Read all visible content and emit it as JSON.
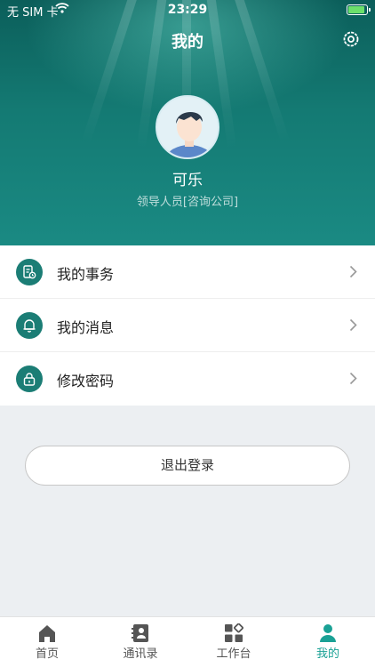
{
  "status_bar": {
    "carrier": "无 SIM 卡",
    "time": "23:29"
  },
  "header": {
    "title": "我的",
    "settings_icon": "gear-icon"
  },
  "profile": {
    "name": "可乐",
    "role": "领导人员[咨询公司]"
  },
  "menu": [
    {
      "label": "我的事务",
      "icon": "document-clock-icon"
    },
    {
      "label": "我的消息",
      "icon": "bell-icon"
    },
    {
      "label": "修改密码",
      "icon": "lock-icon"
    }
  ],
  "logout_label": "退出登录",
  "tabs": [
    {
      "label": "首页",
      "icon": "home-icon",
      "active": false
    },
    {
      "label": "通讯录",
      "icon": "contacts-icon",
      "active": false
    },
    {
      "label": "工作台",
      "icon": "workbench-icon",
      "active": false
    },
    {
      "label": "我的",
      "icon": "person-icon",
      "active": true
    }
  ],
  "colors": {
    "accent": "#1aa195",
    "header_dark": "#0b5e5a",
    "menu_icon_bg": "#1b7d75"
  }
}
